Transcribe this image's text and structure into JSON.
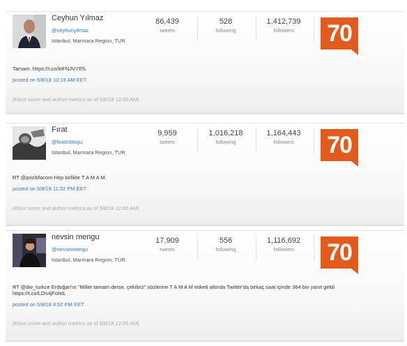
{
  "results": [
    {
      "name": "Ceyhun Yılmaz",
      "handle": "@ceyhunyilmaz",
      "location": "Istanbul, Marmara Region, TUR",
      "metrics": [
        {
          "value": "86,439",
          "label": "tweets"
        },
        {
          "value": "528",
          "label": "following"
        },
        {
          "value": "1,412,739",
          "label": "followers"
        }
      ],
      "klout_score": "70",
      "tweet": "Tamam. https://t.co/ktFNJVYEfL",
      "posted": "posted on 5/8/18 10:19 AM EET",
      "meta": "(Klout score and author metrics as of 5/8/18 12:00 AM)"
    },
    {
      "name": "Fırat",
      "handle": "@firatinblogu",
      "location": "Istanbul, Marmara Region, TUR",
      "metrics": [
        {
          "value": "9,959",
          "label": "tweets"
        },
        {
          "value": "1,016,218",
          "label": "following"
        },
        {
          "value": "1,164,443",
          "label": "followers"
        }
      ],
      "klout_score": "70",
      "tweet": "RT @pozitifacom Hep birlikte T A M A M.",
      "posted": "posted on 5/8/18 11:32 PM EET",
      "meta": "(Klout score and author metrics as of 5/8/18 12:00 AM)"
    },
    {
      "name": "nevsin mengu",
      "handle": "@nevsinmengu",
      "location": "Istanbul, Marmara Region, TUR",
      "metrics": [
        {
          "value": "17,909",
          "label": "tweets"
        },
        {
          "value": "556",
          "label": "following"
        },
        {
          "value": "1,116,692",
          "label": "followers"
        }
      ],
      "klout_score": "70",
      "tweet": "RT @dw_turkce Erdoğan'ın \"Millet tamam derse, çekiliriz\" sözlerine T A M A M etiketi altında Twitter'da birkaç saat içinde 364 bin yanıt geldi https://t.co/LDn4jFoNIL",
      "posted": "posted on 5/8/18 4:52 PM EET",
      "meta": "(Klout score and author metrics as of 5/8/18 12:00 AM)"
    }
  ]
}
